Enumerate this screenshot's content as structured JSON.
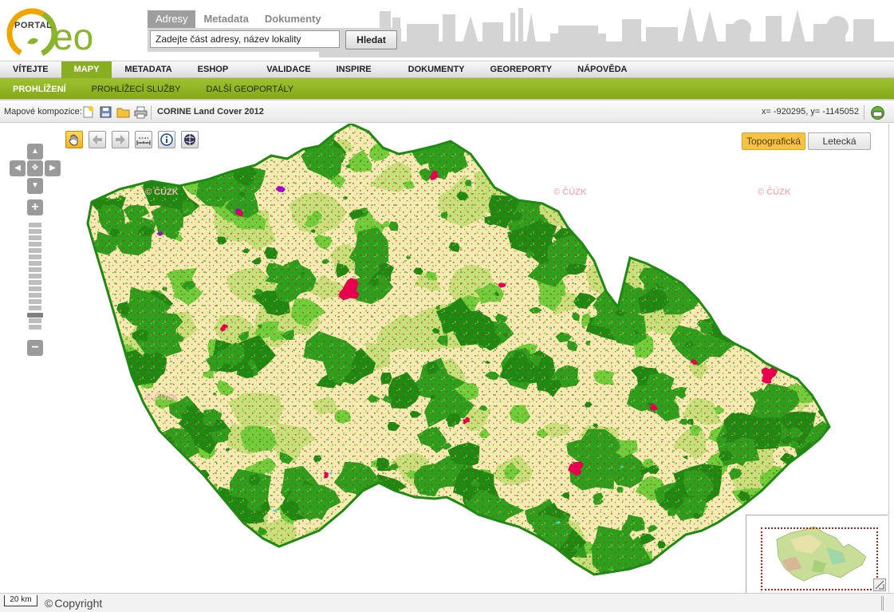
{
  "logo": {
    "small_text": "PORTAL",
    "big_text": "Geo"
  },
  "search": {
    "tabs": [
      "Adresy",
      "Metadata",
      "Dokumenty"
    ],
    "placeholder": "Zadejte část adresy, název lokality",
    "button_label": "Hledat"
  },
  "main_nav": [
    "VÍTEJTE",
    "MAPY",
    "METADATA",
    "ESHOP",
    "VALIDACE",
    "INSPIRE",
    "DOKUMENTY",
    "GEOREPORTY",
    "NÁPOVĚDA"
  ],
  "main_nav_active": "MAPY",
  "sub_nav": [
    "PROHLÍŽENÍ",
    "PROHLÍŽECÍ SLUŽBY",
    "DALŠÍ GEOPORTÁLY"
  ],
  "toolbar": {
    "compositions_label": "Mapové kompozice:",
    "map_title": "CORINE Land Cover 2012",
    "coordinates": "x= -920295, y= -1145052"
  },
  "map": {
    "watermark": "© ČÚZK",
    "base_layers": [
      "Topografická",
      "Letecká"
    ],
    "active_base_layer": "Topografická",
    "tools": [
      "hand-pan-icon",
      "back-arrow-icon",
      "forward-arrow-icon",
      "measure-icon",
      "info-icon",
      "globe-icon"
    ],
    "colors": {
      "forest": "#2ca01c",
      "forest_dark": "#1d8a12",
      "grassland": "#6fcf3b",
      "arable": "#f3ebb0",
      "mixed": "#c8e07a",
      "urban": "#e6004d",
      "industry": "#a600cc",
      "water": "#4dd5e8"
    }
  },
  "statusbar": {
    "scale": "20 km",
    "copyright_symbol": "©",
    "copyright": "Copyright"
  }
}
